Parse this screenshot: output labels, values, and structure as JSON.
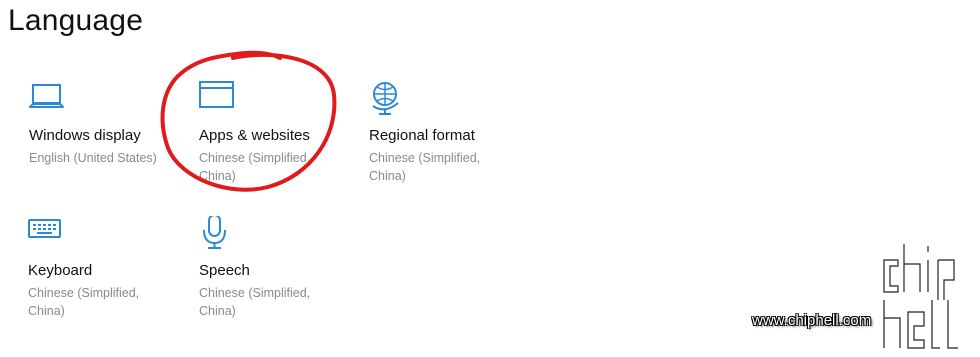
{
  "page": {
    "title": "Language"
  },
  "tiles": {
    "windows_display": {
      "icon": "laptop-icon",
      "title": "Windows display",
      "subtitle": "English (United States)"
    },
    "apps_websites": {
      "icon": "window-icon",
      "title": "Apps & websites",
      "subtitle": "Chinese (Simplified, China)"
    },
    "regional_format": {
      "icon": "globe-icon",
      "title": "Regional format",
      "subtitle": "Chinese (Simplified, China)"
    },
    "keyboard": {
      "icon": "keyboard-icon",
      "title": "Keyboard",
      "subtitle": "Chinese (Simplified, China)"
    },
    "speech": {
      "icon": "microphone-icon",
      "title": "Speech",
      "subtitle": "Chinese (Simplified, China)"
    }
  },
  "annotation": {
    "type": "hand-drawn-circle",
    "color": "#e01b1b"
  },
  "watermark": {
    "url": "www.chiphell.com",
    "logo_text": "chip hell"
  },
  "colors": {
    "accent": "#2b8ad8",
    "subtitle": "#8a8a8a"
  }
}
